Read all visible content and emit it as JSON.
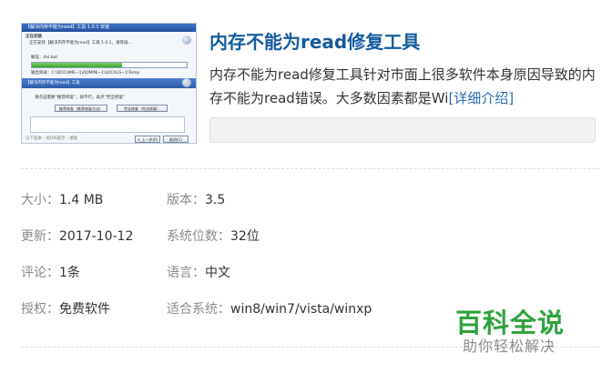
{
  "product": {
    "title": "内存不能为read修复工具",
    "description": "内存不能为read修复工具针对市面上很多软件本身原因导致的内存不能为read错误。大多数因素都是Wi",
    "detail_link": "[详细介绍]"
  },
  "thumbnail": {
    "window_title": "【解决内存不能为read】工具 1.0.1 安装",
    "header_line1": "正在安装",
    "header_line2": "正在安装【解决内存不能为read】工具 1.0.1，请等候…",
    "extract_label": "解压：dxl.bat",
    "path_line": "输出目录：C:\\DOCUME~1\\ADMINI~1\\LOCALS~1\\Temp",
    "section_title": "【解决内存不能为read】工具",
    "hint": "请点击需要“推荐修复”，如不行，再点“完全修复”",
    "btn_recommend": "推荐修复（推荐修复方法）",
    "btn_full": "完全修复（完全修复）",
    "footer": "以下是本 - 名DIS提示 - 请复",
    "btn_back": "< 上一步(P)",
    "btn_cancel": "取消(C)",
    "progress": 0.58
  },
  "info": {
    "size_label": "大小：",
    "size_value": "1.4 MB",
    "version_label": "版本：",
    "version_value": "3.5",
    "updated_label": "更新：",
    "updated_value": "2017-10-12",
    "bits_label": "系统位数：",
    "bits_value": "32位",
    "comments_label": "评论：",
    "comments_value": "1条",
    "language_label": "语言：",
    "language_value": "中文",
    "license_label": "授权：",
    "license_value": "免费软件",
    "os_label": "适合系统：",
    "os_value": "win8/win7/vista/winxp"
  },
  "watermark": {
    "title": "百科全说",
    "subtitle": "助你轻松解决"
  }
}
